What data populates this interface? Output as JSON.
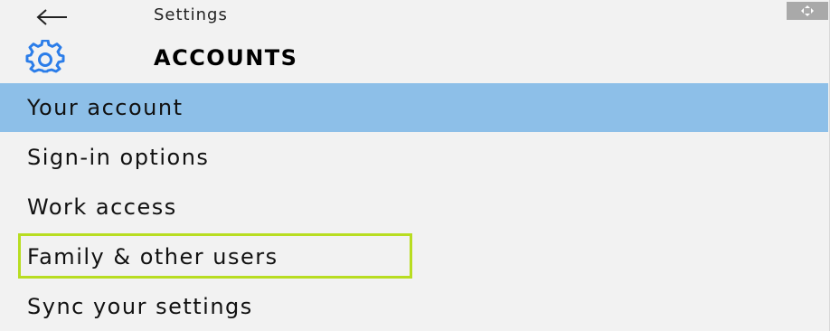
{
  "header": {
    "back_icon": "back-arrow-icon",
    "app_title": "Settings",
    "corner_icon": "move-icon"
  },
  "section": {
    "icon": "gear-icon",
    "title": "ACCOUNTS",
    "accent_color": "#2b7de9"
  },
  "nav": {
    "selected_color": "#8dbfe8",
    "highlight_color": "#b8dd21",
    "items": [
      {
        "label": "Your account",
        "selected": true
      },
      {
        "label": "Sign-in options",
        "selected": false
      },
      {
        "label": "Work access",
        "selected": false
      },
      {
        "label": "Family & other users",
        "selected": false,
        "highlighted": true
      },
      {
        "label": "Sync your settings",
        "selected": false
      }
    ]
  }
}
